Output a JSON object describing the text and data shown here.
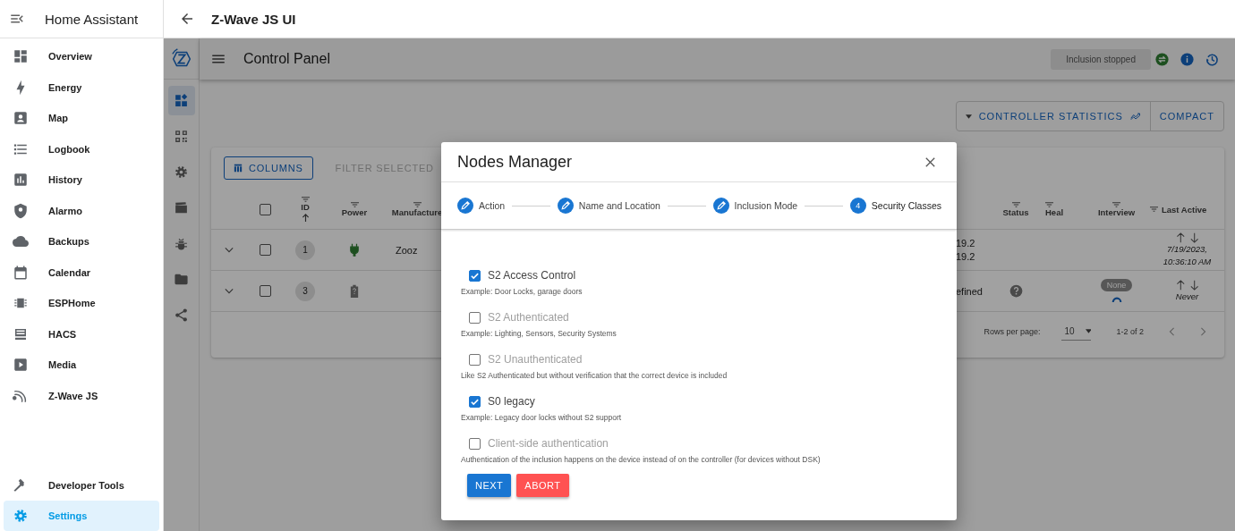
{
  "sidebar": {
    "title": "Home Assistant",
    "items": [
      {
        "label": "Overview",
        "selected": false
      },
      {
        "label": "Energy",
        "selected": false
      },
      {
        "label": "Map",
        "selected": false
      },
      {
        "label": "Logbook",
        "selected": false
      },
      {
        "label": "History",
        "selected": false
      },
      {
        "label": "Alarmo",
        "selected": false
      },
      {
        "label": "Backups",
        "selected": false
      },
      {
        "label": "Calendar",
        "selected": false
      },
      {
        "label": "ESPHome",
        "selected": false
      },
      {
        "label": "HACS",
        "selected": false
      },
      {
        "label": "Media",
        "selected": false
      },
      {
        "label": "Z-Wave JS",
        "selected": false
      }
    ],
    "bottom_items": [
      {
        "label": "Developer Tools",
        "selected": false
      },
      {
        "label": "Settings",
        "selected": true
      }
    ]
  },
  "topbar": {
    "title": "Z-Wave JS UI"
  },
  "nav_rail": [
    {
      "selected": true
    },
    {
      "selected": false
    },
    {
      "selected": false
    },
    {
      "selected": false
    },
    {
      "selected": false
    },
    {
      "selected": false
    },
    {
      "selected": false
    }
  ],
  "header": {
    "title": "Control Panel",
    "status_chip": "Inclusion stopped"
  },
  "stats_buttons": [
    "CONTROLLER STATISTICS",
    "COMPACT"
  ],
  "table": {
    "toolbar": [
      "COLUMNS",
      "FILTER SELECTED"
    ],
    "all_selected": false,
    "columns": [
      {
        "label": "ID",
        "sorted": true
      },
      {
        "label": "Power",
        "sorted": false
      },
      {
        "label": "Manufacture",
        "sorted": false
      },
      {
        "label": "Status",
        "sorted": false
      },
      {
        "label": "Heal",
        "sorted": false
      },
      {
        "label": "Interview",
        "sorted": false
      },
      {
        "label": "Last Active",
        "sorted": false
      }
    ],
    "rows": [
      {
        "id": "1",
        "selected": false,
        "mains_powered": true,
        "manufacturer": "Zooz",
        "version": [
          "19.2",
          "19.2"
        ],
        "status_unknown": false,
        "last_active": "7/19/2023, 10:36:10 AM"
      },
      {
        "id": "3",
        "selected": false,
        "mains_powered": false,
        "version": [
          "efined"
        ],
        "status_unknown": true,
        "interview": "None",
        "last_active": "Never"
      }
    ],
    "pagination": {
      "label": "Rows per page:",
      "rows_per_page": "10",
      "range": "1-2 of 2"
    }
  },
  "dialog": {
    "title": "Nodes Manager",
    "steps": [
      {
        "label": "Action",
        "kind": "done"
      },
      {
        "label": "Name and Location",
        "kind": "done"
      },
      {
        "label": "Inclusion Mode",
        "kind": "done"
      },
      {
        "label": "Security Classes",
        "kind": "current",
        "number": "4"
      }
    ],
    "options": [
      {
        "label": "S2 Access Control",
        "description": "Example: Door Locks, garage doors",
        "checked": true
      },
      {
        "label": "S2 Authenticated",
        "description": "Example: Lighting, Sensors, Security Systems",
        "checked": false
      },
      {
        "label": "S2 Unauthenticated",
        "description": "Like S2 Authenticated but without verification that the correct device is included",
        "checked": false
      },
      {
        "label": "S0 legacy",
        "description": "Example: Legacy door locks without S2 support",
        "checked": true
      },
      {
        "label": "Client-side authentication",
        "description": "Authentication of the inclusion happens on the device instead of on the controller (for devices without DSK)",
        "checked": false
      }
    ],
    "buttons": [
      "NEXT",
      "ABORT"
    ]
  }
}
